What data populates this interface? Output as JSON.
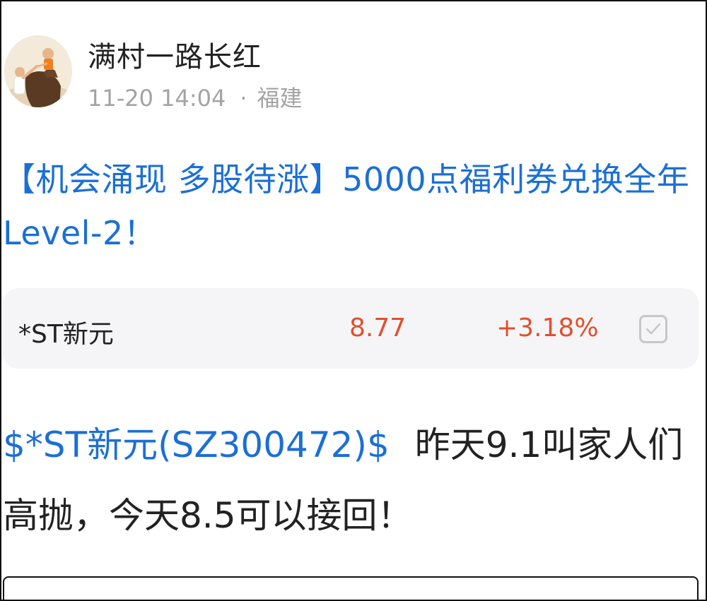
{
  "post": {
    "author": "满村一路长红",
    "time": "11-20 14:04",
    "dot": "·",
    "location": "福建",
    "headline": "【机会涌现 多股待涨】5000点福利券兑换全年Level-2！"
  },
  "stock_card": {
    "name": "*ST新元",
    "price": "8.77",
    "change": "+3.18%",
    "watch_icon": "checkbox-icon",
    "price_color": "#e0502c"
  },
  "content": {
    "stock_tag": "$*ST新元(SZ300472)$",
    "text": "昨天9.1叫家人们高抛，今天8.5可以接回！"
  },
  "colors": {
    "link": "#1b6fd6",
    "up": "#e0502c",
    "meta": "#a3a3a3"
  }
}
